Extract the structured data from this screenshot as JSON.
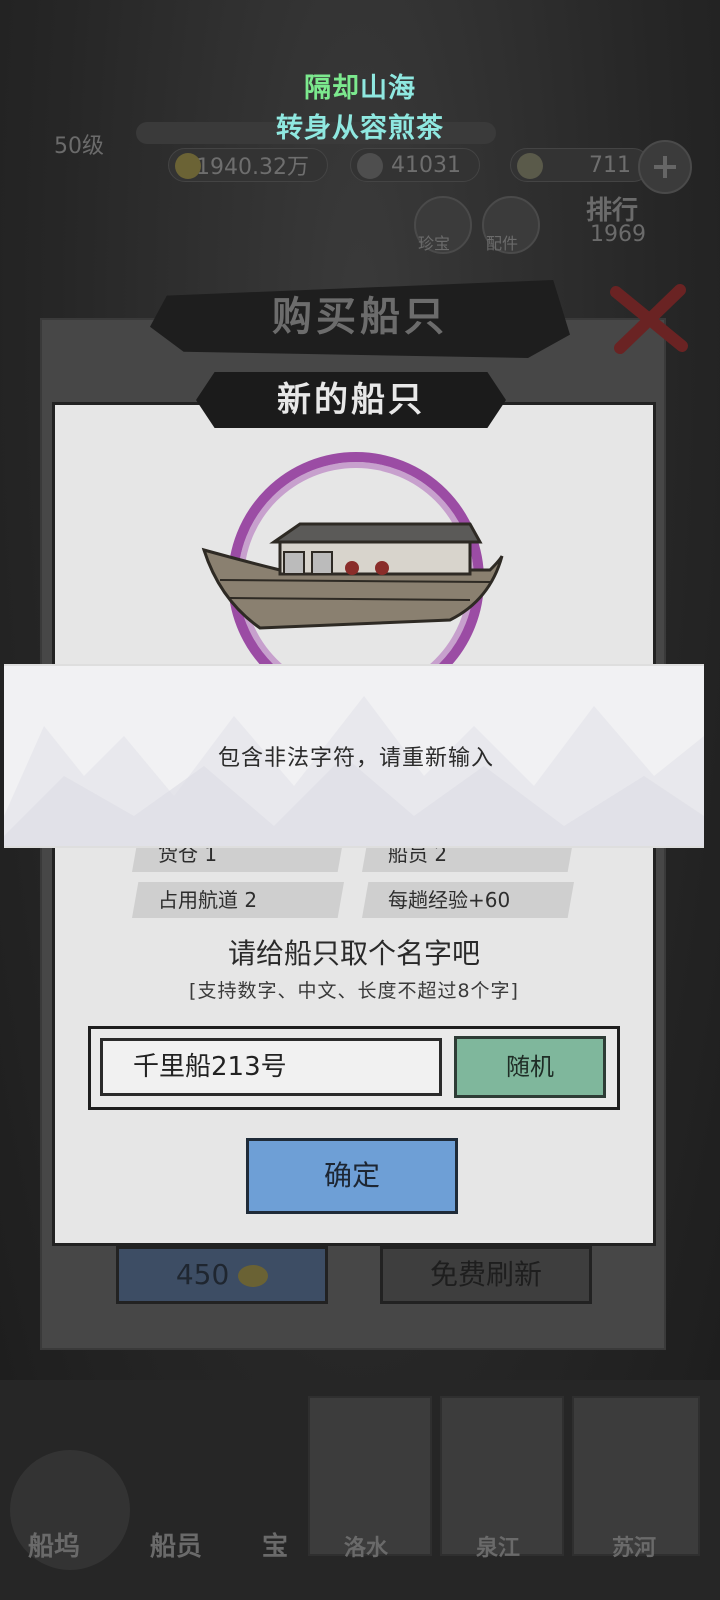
{
  "toast": {
    "line1_highlight": "隔却",
    "line1_rest": "山海",
    "line2": "转身从容煎茶"
  },
  "hud": {
    "level": "50级",
    "silver": "1940.32万",
    "copper": "41031",
    "gold": "711",
    "treasure_label": "珍宝",
    "ranking_label": "排行",
    "ranking_value": "1969",
    "accessory_label": "配件"
  },
  "panel": {
    "title": "购买船只",
    "subtitle": "新的船只",
    "stats": {
      "cargo": "货仓 1",
      "crew": "船员 2",
      "lanes": "占用航道 2",
      "exp": "每趟经验+60"
    },
    "prompt_title": "请给船只取个名字吧",
    "prompt_hint": "[支持数字、中文、长度不超过8个字]",
    "name_value": "千里船213号",
    "random_label": "随机",
    "confirm_label": "确定",
    "buy_cost": "450",
    "refresh_label": "免费刷新"
  },
  "alert": {
    "message": "包含非法字符，请重新输入"
  },
  "nav": {
    "dock": "船坞",
    "crew": "船员",
    "treasure": "宝",
    "route1": "洛水",
    "route2": "泉江",
    "route3": "苏河"
  },
  "colors": {
    "toast_green": "#7ce98e",
    "toast_cyan": "#8fe8e0",
    "ring_purple": "#9b4ca4",
    "random_green": "#7fb79c",
    "confirm_blue": "#6e9fd6"
  }
}
